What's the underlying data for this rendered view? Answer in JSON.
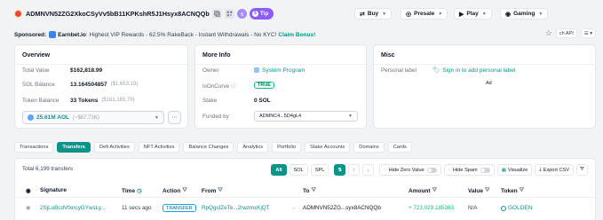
{
  "header": {
    "address": "ADMNVN52ZG2XkoCSyVv5bB11KPKshR5J1Hsyx8ACNQQb",
    "tip_label": "Tip",
    "buy_label": "Buy",
    "presale_label": "Presale",
    "play_label": "Play",
    "gaming_label": "Gaming"
  },
  "sponsored": {
    "prefix": "Sponsored:",
    "brand": "Earnbet.io",
    "text": ": Highest VIP Rewards - 62.5% RakeBack - Instant Withdrawals - No KYC!",
    "cta": "Claim Bonus!",
    "lang": "ch API"
  },
  "overview": {
    "title": "Overview",
    "total_value_label": "Total Value",
    "total_value": "$162,818.99",
    "sol_balance_label": "SOL Balance",
    "sol_balance": "13.164504857",
    "sol_balance_usd": "($1,653.19)",
    "token_balance_label": "Token Balance",
    "token_balance": "33 Tokens",
    "token_balance_usd": "($161,165.79)",
    "token_select": "25.61M AOL",
    "token_select_usd": "(~$87.71K)"
  },
  "more_info": {
    "title": "More Info",
    "owner_label": "Owner",
    "owner": "System Program",
    "isoncurve_label": "IsOnCurve",
    "isoncurve": "TRUE",
    "stake_label": "Stake",
    "stake": "0 SOL",
    "funded_label": "Funded by",
    "funded": "ADMNC4...5D4gL4"
  },
  "misc": {
    "title": "Misc",
    "personal_label": "Personal label",
    "signin": "Sign in to add personal label",
    "ad": "Ad"
  },
  "tabs": [
    "Transactions",
    "Transfers",
    "Defi Activities",
    "NFT Activities",
    "Balance Changes",
    "Analytics",
    "Portfolio",
    "Stake Accounts",
    "Domains",
    "Cards"
  ],
  "table": {
    "total": "Total 6,199 transfers",
    "filters": [
      "All",
      "SOL",
      "SPL"
    ],
    "hide_zero": "Hide Zero Value",
    "hide_spam": "Hide Spam",
    "visualize": "Visualize",
    "export": "Export CSV",
    "columns": [
      "Signature",
      "Time",
      "Action",
      "From",
      "To",
      "Amount",
      "Value",
      "Token"
    ],
    "rows": [
      {
        "signature": "2SjLuBcdVfxncyGYwsLy...",
        "time": "11 secs ago",
        "action": "TRANSFER",
        "from": "RpQgsfZeTe...2rwzmxKjQT",
        "to": "ADMNVN52ZG...syx8ACNQQb",
        "amount": "+ 723,029.185383",
        "value": "N/A",
        "token": "GOLDEN"
      }
    ]
  },
  "colors": {
    "accent": "#0d9488",
    "brand_purple": "#8b5cf6"
  }
}
